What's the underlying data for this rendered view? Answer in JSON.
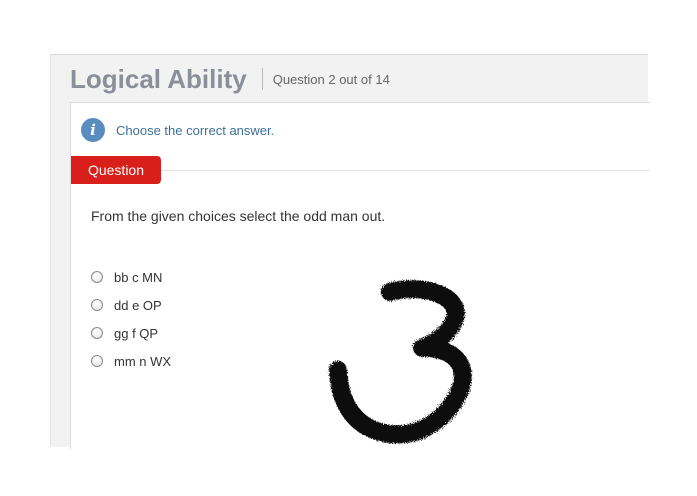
{
  "header": {
    "module_title": "Logical Ability",
    "question_count": "Question 2 out of 14"
  },
  "info": {
    "icon": "info-icon",
    "text": "Choose the correct answer."
  },
  "question": {
    "tab_label": "Question",
    "text": "From the given choices select the odd man out.",
    "options": [
      "bb c MN",
      "dd e OP",
      "gg f QP",
      "mm n WX"
    ]
  },
  "overlay": {
    "glyph": "3",
    "color": "#111111"
  }
}
